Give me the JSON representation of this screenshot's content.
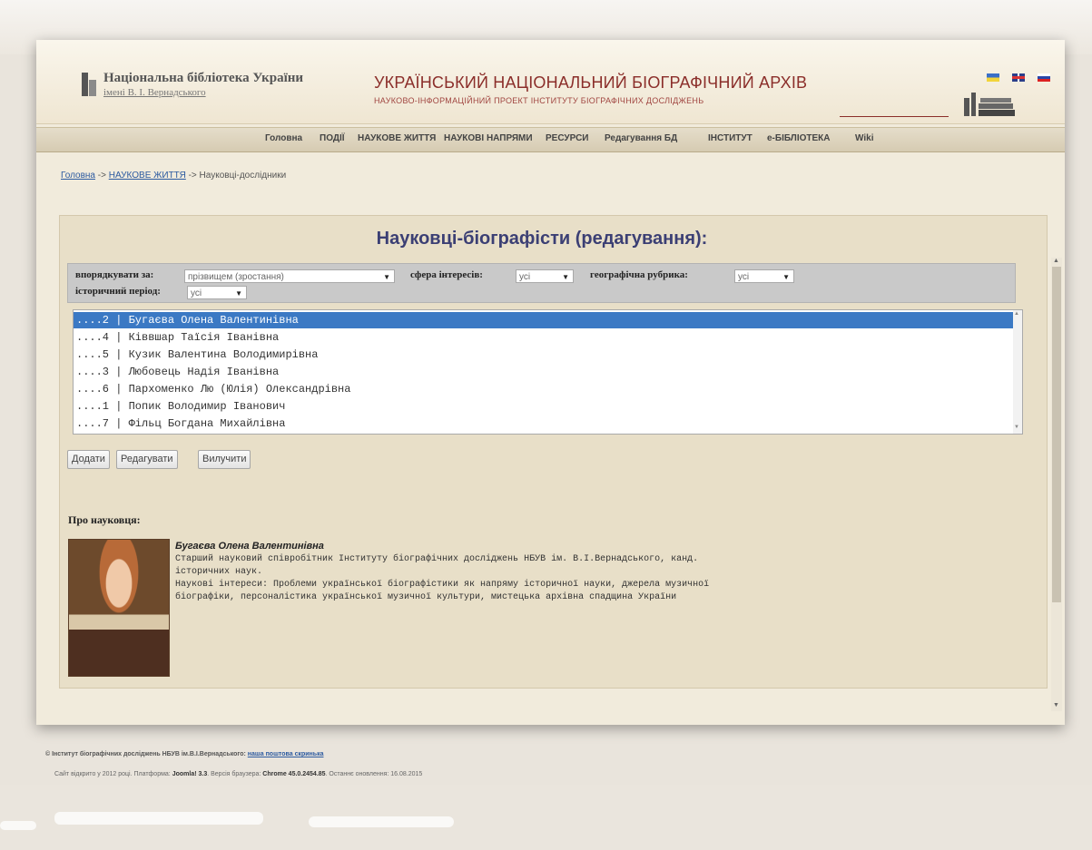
{
  "header": {
    "library_name": "Національна бібліотека України",
    "library_sub": "імені В. І. Вернадського",
    "site_title": "УКРАЇНСЬКИЙ НАЦІОНАЛЬНИЙ БІОГРАФІЧНИЙ АРХІВ",
    "site_subtitle": "НАУКОВО-ІНФОРМАЦІЙНИЙ ПРОЕКТ ІНСТИТУТУ БІОГРАФІЧНИХ ДОСЛІДЖЕНЬ",
    "flags": [
      "ua",
      "uk",
      "ru"
    ]
  },
  "nav": {
    "items": [
      "Головна",
      "ПОДІЇ",
      "НАУКОВЕ ЖИТТЯ",
      "НАУКОВІ НАПРЯМИ",
      "РЕСУРСИ",
      "Редагування БД",
      "ІНСТИТУТ",
      "е-БІБЛІОТЕКА",
      "Wiki"
    ]
  },
  "breadcrumb": {
    "home": "Головна",
    "sep": "->",
    "section": "НАУКОВЕ ЖИТТЯ",
    "current": "Науковці-дослідники"
  },
  "panel": {
    "title": "Науковці-біографісти (редагування):",
    "filters": {
      "sort_label": "впорядкувати за:",
      "sort_value": "прізвищем (зростання)",
      "sphere_label": "сфера інтересів:",
      "sphere_value": "усі",
      "geo_label": "географічна рубрика:",
      "geo_value": "усі",
      "period_label": "історичний період:",
      "period_value": "усі"
    },
    "list": [
      "....2 | Бугаєва Олена Валентинівна",
      "....4 | Ківвшар Таїсія Іванівна",
      "....5 | Кузик Валентина Володимирівна",
      "....3 | Любовець Надія Іванівна",
      "....6 | Пархоменко Лю (Юлія) Олександрівна",
      "....1 | Попик Володимир Іванович",
      "....7 | Фільц Богдана Михайлівна"
    ],
    "selected_index": 0,
    "buttons": {
      "add": "Додати",
      "edit": "Редагувати",
      "delete": "Вилучити"
    },
    "about_label": "Про науковця:",
    "bio": {
      "name": "Бугаєва Олена Валентинівна",
      "lines": [
        "Старший науковий співробітник Інституту біографічних досліджень НБУВ ім. В.І.Вернадського, канд.",
        "історичних наук.",
        "Наукові інтереси: Проблеми української біографістики як напряму історичної науки, джерела музичної",
        "біографіки, персоналістика української музичної культури, мистецька архівна спадщина України"
      ]
    }
  },
  "footer": {
    "line1_text": "© Інститут біографічних досліджень НБУВ ім.В.І.Вернадського:",
    "line1_link": "наша поштова скринька",
    "line2_a": "Сайт відкрито у 2012 році. Платформа:",
    "line2_joomla": "Joomla! 3.3",
    "line2_b": ". Версія браузера:",
    "line2_chrome": "Chrome 45.0.2454.85",
    "line2_c": ". Останнє оновлення: 16.08.2015"
  },
  "colors": {
    "accent_title": "#3b3f74",
    "site_title": "#8b2e2a",
    "selection": "#3b79c4",
    "link": "#2c5aa0"
  }
}
